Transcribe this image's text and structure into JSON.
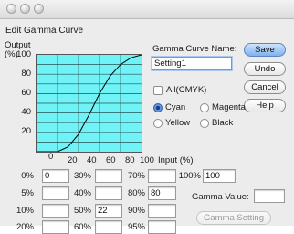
{
  "window": {
    "title": "",
    "dialog_title": "Edit Gamma Curve"
  },
  "chart_data": {
    "type": "line",
    "title": "",
    "ylabel": "Output\n(%)",
    "xlabel": "Input (%)",
    "xlim": [
      0,
      100
    ],
    "ylim": [
      0,
      100
    ],
    "grid": true,
    "background": "#6ff3f6",
    "x_ticks": [
      "0",
      "20",
      "40",
      "60",
      "80",
      "100"
    ],
    "y_ticks": [
      "100",
      "80",
      "60",
      "40",
      "20",
      "0"
    ],
    "series": [
      {
        "x": [
          0,
          10,
          20,
          30,
          40,
          50,
          60,
          70,
          80,
          90,
          100
        ],
        "y": [
          0,
          0,
          0,
          5,
          18,
          38,
          60,
          78,
          90,
          97,
          100
        ]
      }
    ]
  },
  "name_label": "Gamma Curve Name:",
  "name_value": "Setting1",
  "buttons": {
    "save": "Save",
    "undo": "Undo",
    "cancel": "Cancel",
    "help": "Help",
    "gamma_setting": "Gamma Setting"
  },
  "all_cmyk_label": "All(CMYK)",
  "colors": {
    "cyan": "Cyan",
    "magenta": "Magenta",
    "yellow": "Yellow",
    "black": "Black",
    "selected": "Cyan"
  },
  "gamma_value_label": "Gamma Value:",
  "gamma_value": "",
  "table": {
    "col1": [
      {
        "label": "0%",
        "value": "0"
      },
      {
        "label": "5%",
        "value": ""
      },
      {
        "label": "10%",
        "value": ""
      },
      {
        "label": "20%",
        "value": ""
      }
    ],
    "col2": [
      {
        "label": "30%",
        "value": ""
      },
      {
        "label": "40%",
        "value": ""
      },
      {
        "label": "50%",
        "value": "22"
      },
      {
        "label": "60%",
        "value": ""
      }
    ],
    "col3": [
      {
        "label": "70%",
        "value": ""
      },
      {
        "label": "80%",
        "value": "80"
      },
      {
        "label": "90%",
        "value": ""
      },
      {
        "label": "95%",
        "value": ""
      }
    ],
    "col4": [
      {
        "label": "100%",
        "value": "100"
      }
    ]
  }
}
